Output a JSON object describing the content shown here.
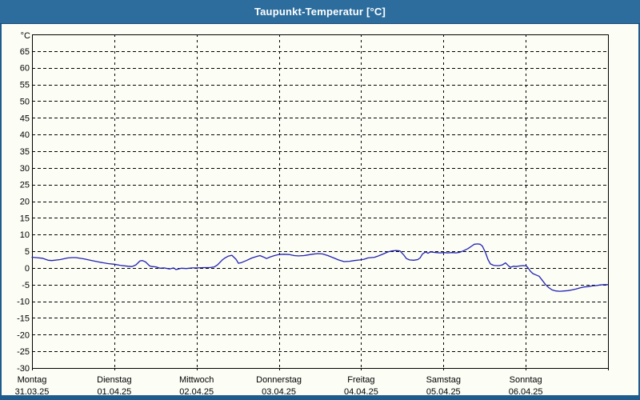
{
  "window": {
    "title": "Taupunkt-Temperatur [°C]",
    "title_bar_color": "#2C6D9E",
    "frame_color": "#1E5C8E",
    "background_color": "#FCFDF5"
  },
  "chart_data": {
    "type": "line",
    "title": "Taupunkt-Temperatur [°C]",
    "ylabel": "°C",
    "xlabel": "",
    "ylim": [
      -30,
      70
    ],
    "xlim_hours": [
      0,
      168
    ],
    "grid": true,
    "legend_position": "none",
    "line_color": "#2222B2",
    "grid_color": "#000000",
    "y_ticks": [
      65,
      60,
      55,
      50,
      45,
      40,
      35,
      30,
      25,
      20,
      15,
      10,
      5,
      0,
      -5,
      -10,
      -15,
      -20,
      -25,
      -30
    ],
    "x_days": [
      {
        "name": "Montag",
        "date": "31.03.25"
      },
      {
        "name": "Dienstag",
        "date": "01.04.25"
      },
      {
        "name": "Mittwoch",
        "date": "02.04.25"
      },
      {
        "name": "Donnerstag",
        "date": "03.04.25"
      },
      {
        "name": "Freitag",
        "date": "04.04.25"
      },
      {
        "name": "Samstag",
        "date": "05.04.25"
      },
      {
        "name": "Sonntag",
        "date": "06.04.25"
      }
    ],
    "series": [
      {
        "name": "Taupunkt-Temperatur",
        "points_hour_value": [
          [
            0,
            3.2
          ],
          [
            1.2,
            3.1
          ],
          [
            3,
            2.9
          ],
          [
            4.7,
            2.3
          ],
          [
            5.8,
            2.2
          ],
          [
            8.2,
            2.5
          ],
          [
            10.5,
            3
          ],
          [
            11.7,
            3.1
          ],
          [
            12.8,
            3.1
          ],
          [
            15.2,
            2.7
          ],
          [
            17.5,
            2.2
          ],
          [
            19.8,
            1.7
          ],
          [
            22.2,
            1.3
          ],
          [
            24,
            1.1
          ],
          [
            25.7,
            0.8
          ],
          [
            28,
            0.5
          ],
          [
            29.2,
            0.4
          ],
          [
            30.3,
            0.9
          ],
          [
            31.5,
            2.1
          ],
          [
            32.2,
            2.2
          ],
          [
            33.1,
            1.8
          ],
          [
            34.3,
            0.6
          ],
          [
            35,
            0.4
          ],
          [
            36.2,
            0.3
          ],
          [
            37.3,
            -0.1
          ],
          [
            38.5,
            0
          ],
          [
            40.1,
            -0.3
          ],
          [
            41.3,
            0
          ],
          [
            42,
            -0.5
          ],
          [
            43.6,
            -0.1
          ],
          [
            45,
            -0.2
          ],
          [
            46.7,
            0
          ],
          [
            48,
            0
          ],
          [
            50.2,
            0.1
          ],
          [
            51.8,
            0.1
          ],
          [
            53.2,
            0.3
          ],
          [
            54.1,
            0.9
          ],
          [
            55.5,
            2.4
          ],
          [
            56.3,
            3
          ],
          [
            57.2,
            3.5
          ],
          [
            58.3,
            3.8
          ],
          [
            59.5,
            2.6
          ],
          [
            60.2,
            1.4
          ],
          [
            61.1,
            1.6
          ],
          [
            62.5,
            2.2
          ],
          [
            64.2,
            3
          ],
          [
            65.8,
            3.5
          ],
          [
            66.5,
            3.7
          ],
          [
            67.7,
            3.2
          ],
          [
            68.4,
            2.8
          ],
          [
            69.5,
            3.3
          ],
          [
            70.7,
            3.7
          ],
          [
            71.9,
            4
          ],
          [
            73.5,
            4.1
          ],
          [
            75.1,
            4
          ],
          [
            76.5,
            3.7
          ],
          [
            77.7,
            3.6
          ],
          [
            79.3,
            3.7
          ],
          [
            81.7,
            4.1
          ],
          [
            83.3,
            4.3
          ],
          [
            84.7,
            4.2
          ],
          [
            86.3,
            3.7
          ],
          [
            88,
            3
          ],
          [
            89.4,
            2.4
          ],
          [
            91,
            1.9
          ],
          [
            92.6,
            2
          ],
          [
            94,
            2.2
          ],
          [
            95.7,
            2.4
          ],
          [
            96.8,
            2.6
          ],
          [
            98,
            3
          ],
          [
            98.9,
            3.1
          ],
          [
            99.9,
            3.2
          ],
          [
            100.8,
            3.5
          ],
          [
            101.5,
            3.8
          ],
          [
            102.7,
            4.3
          ],
          [
            103.8,
            4.8
          ],
          [
            105,
            5.1
          ],
          [
            106.2,
            5.2
          ],
          [
            107.3,
            5.1
          ],
          [
            108.5,
            3.8
          ],
          [
            109.2,
            2.8
          ],
          [
            110.1,
            2.4
          ],
          [
            111.3,
            2.3
          ],
          [
            112.5,
            2.5
          ],
          [
            113.2,
            3
          ],
          [
            113.9,
            4.2
          ],
          [
            114.8,
            4.8
          ],
          [
            115.5,
            4.4
          ],
          [
            116.2,
            4.8
          ],
          [
            117.8,
            4.6
          ],
          [
            119,
            4.5
          ],
          [
            120.2,
            4.6
          ],
          [
            121.3,
            4.5
          ],
          [
            122.5,
            4.6
          ],
          [
            123.7,
            4.5
          ],
          [
            124.8,
            4.7
          ],
          [
            126,
            5.2
          ],
          [
            127.2,
            5.8
          ],
          [
            128.3,
            6.6
          ],
          [
            129,
            7.1
          ],
          [
            130,
            7.2
          ],
          [
            130.7,
            7.1
          ],
          [
            131.4,
            6.5
          ],
          [
            132.3,
            4.5
          ],
          [
            133,
            2.5
          ],
          [
            133.7,
            1.2
          ],
          [
            134.6,
            0.8
          ],
          [
            135.3,
            0.7
          ],
          [
            136.3,
            0.7
          ],
          [
            137.2,
            0.9
          ],
          [
            138.1,
            1.5
          ],
          [
            138.8,
            0.8
          ],
          [
            139.5,
            0.2
          ],
          [
            140.5,
            0.5
          ],
          [
            141.2,
            0.4
          ],
          [
            142.3,
            0.6
          ],
          [
            143.3,
            0.7
          ],
          [
            144.2,
            0.6
          ],
          [
            144.7,
            0
          ],
          [
            145.4,
            -1
          ],
          [
            146.1,
            -1.7
          ],
          [
            147,
            -2.1
          ],
          [
            147.9,
            -2.5
          ],
          [
            148.9,
            -3.8
          ],
          [
            149.8,
            -5
          ],
          [
            150.7,
            -5.9
          ],
          [
            151.7,
            -6.6
          ],
          [
            152.8,
            -6.9
          ],
          [
            154,
            -7
          ],
          [
            155.2,
            -6.9
          ],
          [
            156.3,
            -6.8
          ],
          [
            157.5,
            -6.6
          ],
          [
            158.7,
            -6.3
          ],
          [
            159.8,
            -6
          ],
          [
            161,
            -5.7
          ],
          [
            162.2,
            -5.6
          ],
          [
            163.3,
            -5.4
          ],
          [
            164.5,
            -5.3
          ],
          [
            165.7,
            -5.1
          ],
          [
            166.8,
            -5
          ],
          [
            168,
            -5
          ]
        ]
      }
    ]
  }
}
